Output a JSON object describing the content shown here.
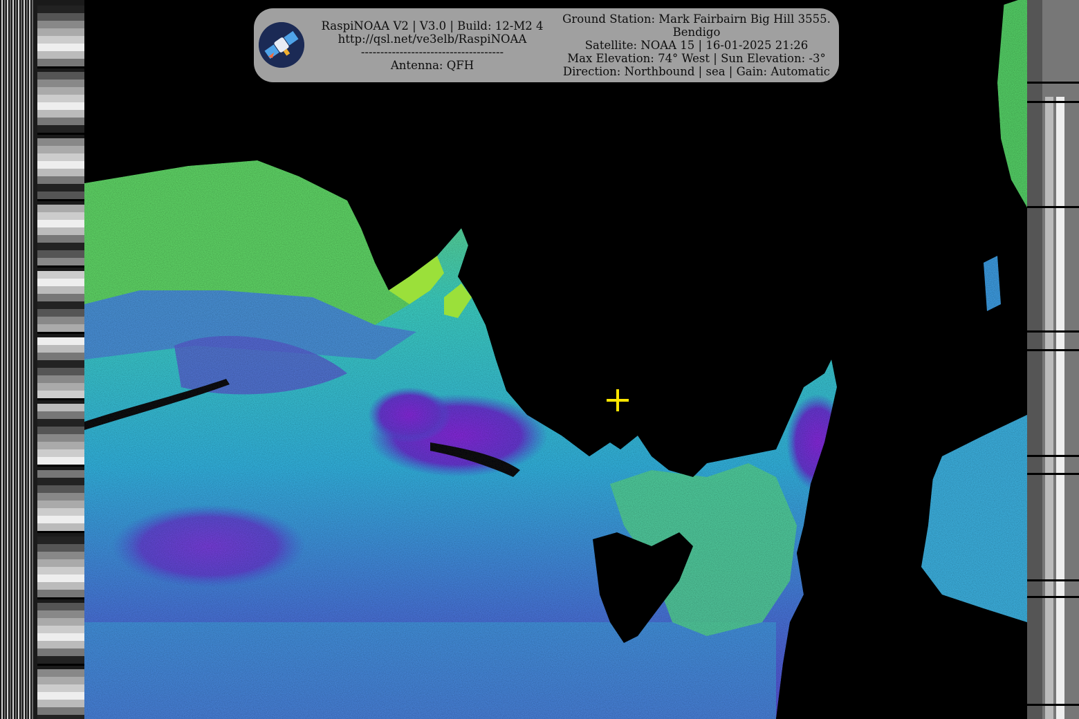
{
  "header": {
    "left_lines": [
      "RaspiNOAA V2 | V3.0 | Build: 12-M2 4",
      "http://qsl.net/ve3elb/RaspiNOAA",
      "-------------------------------------",
      "Antenna: QFH"
    ],
    "right_lines": [
      "Ground Station: Mark Fairbairn Big Hill 3555.",
      "Bendigo",
      "Satellite: NOAA 15 | 16-01-2025 21:26",
      "Max Elevation: 74° West | Sun Elevation: -3°",
      "Direction: Northbound | sea | Gain: Automatic"
    ],
    "logo_icon": "satellite-icon"
  },
  "colors": {
    "background": "#000000",
    "header_bg": "#a0a0a0",
    "crosshair": "#ffe600",
    "palette": [
      "#7a2bd6",
      "#4a5de0",
      "#2fb6e8",
      "#3fe0d0",
      "#5fe07a",
      "#9be03a",
      "#e0c030",
      "#e05020"
    ]
  }
}
